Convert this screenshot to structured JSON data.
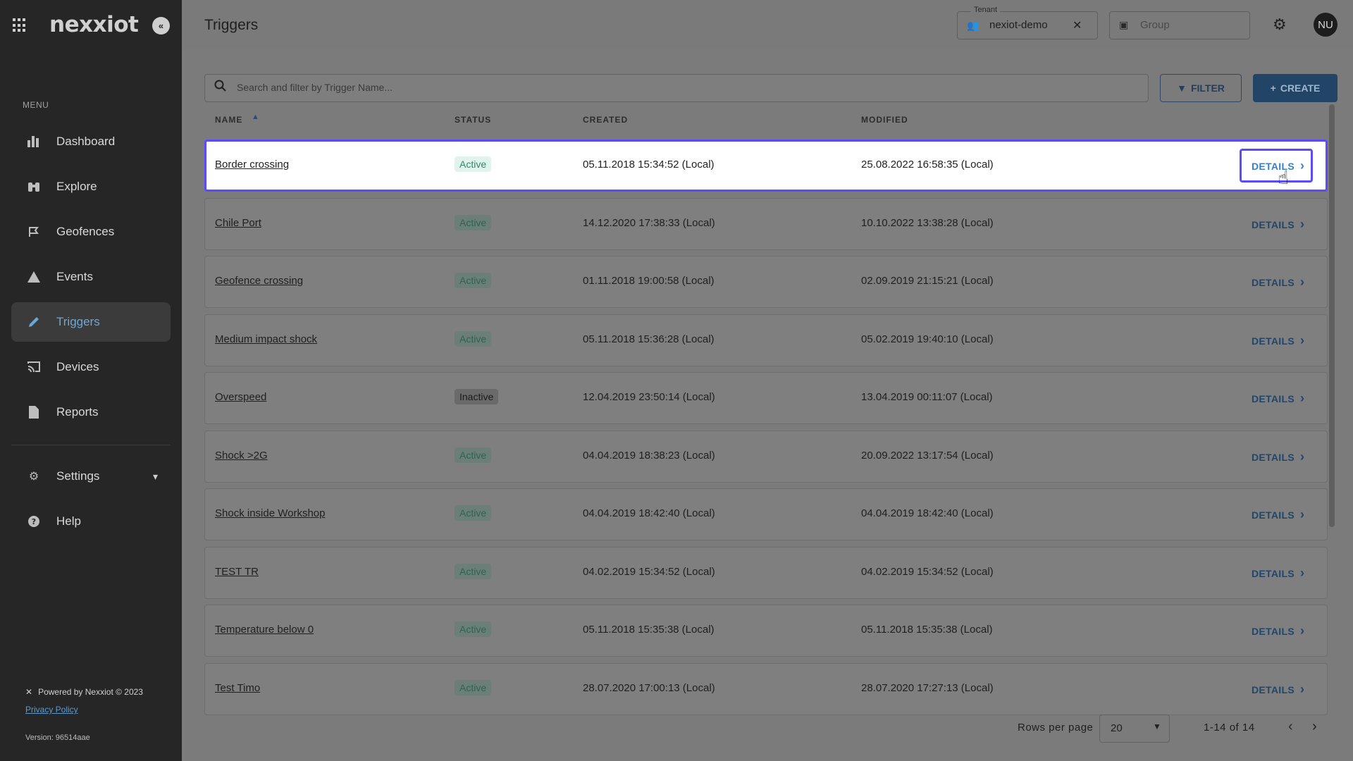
{
  "sidebar": {
    "logo": "nexxiot",
    "menu_label": "MENU",
    "items": [
      {
        "label": "Dashboard",
        "icon": "dashboard-icon"
      },
      {
        "label": "Explore",
        "icon": "binoculars-icon"
      },
      {
        "label": "Geofences",
        "icon": "geofence-icon"
      },
      {
        "label": "Events",
        "icon": "warning-icon"
      },
      {
        "label": "Triggers",
        "icon": "pencil-icon",
        "active": true
      },
      {
        "label": "Devices",
        "icon": "cast-icon"
      },
      {
        "label": "Reports",
        "icon": "document-icon"
      }
    ],
    "settings_label": "Settings",
    "help_label": "Help",
    "powered_by": "Powered by Nexxiot © 2023",
    "privacy": "Privacy Policy",
    "version": "Version: 96514aae"
  },
  "header": {
    "title": "Triggers",
    "tenant_label": "Tenant",
    "tenant_value": "nexiot-demo",
    "group_placeholder": "Group",
    "avatar": "NU"
  },
  "toolbar": {
    "search_placeholder": "Search and filter by Trigger Name...",
    "filter_label": "FILTER",
    "create_label": "CREATE"
  },
  "table": {
    "columns": [
      "NAME",
      "STATUS",
      "CREATED",
      "MODIFIED"
    ],
    "details_label": "DETAILS",
    "rows": [
      {
        "name": "Border crossing",
        "status": "Active",
        "created": "05.11.2018 15:34:52 (Local)",
        "modified": "25.08.2022 16:58:35 (Local)"
      },
      {
        "name": "Chile Port",
        "status": "Active",
        "created": "14.12.2020 17:38:33 (Local)",
        "modified": "10.10.2022 13:38:28 (Local)"
      },
      {
        "name": "Geofence crossing",
        "status": "Active",
        "created": "01.11.2018 19:00:58 (Local)",
        "modified": "02.09.2019 21:15:21 (Local)"
      },
      {
        "name": "Medium impact shock",
        "status": "Active",
        "created": "05.11.2018 15:36:28 (Local)",
        "modified": "05.02.2019 19:40:10 (Local)"
      },
      {
        "name": "Overspeed",
        "status": "Inactive",
        "created": "12.04.2019 23:50:14 (Local)",
        "modified": "13.04.2019 00:11:07 (Local)"
      },
      {
        "name": "Shock >2G",
        "status": "Active",
        "created": "04.04.2019 18:38:23 (Local)",
        "modified": "20.09.2022 13:17:54 (Local)"
      },
      {
        "name": "Shock inside Workshop",
        "status": "Active",
        "created": "04.04.2019 18:42:40 (Local)",
        "modified": "04.04.2019 18:42:40 (Local)"
      },
      {
        "name": "TEST TR",
        "status": "Active",
        "created": "04.02.2019 15:34:52 (Local)",
        "modified": "04.02.2019 15:34:52 (Local)"
      },
      {
        "name": "Temperature below 0",
        "status": "Active",
        "created": "05.11.2018 15:35:38 (Local)",
        "modified": "05.11.2018 15:35:38 (Local)"
      },
      {
        "name": "Test Timo",
        "status": "Active",
        "created": "28.07.2020 17:00:13 (Local)",
        "modified": "28.07.2020 17:27:13 (Local)"
      }
    ]
  },
  "pagination": {
    "rows_per_page_label": "Rows per page",
    "rows_per_page": "20",
    "range": "1-14 of 14"
  },
  "colors": {
    "accent": "#3a7fc7",
    "highlight_border": "#5a4bff",
    "sidebar_bg": "#262626"
  }
}
